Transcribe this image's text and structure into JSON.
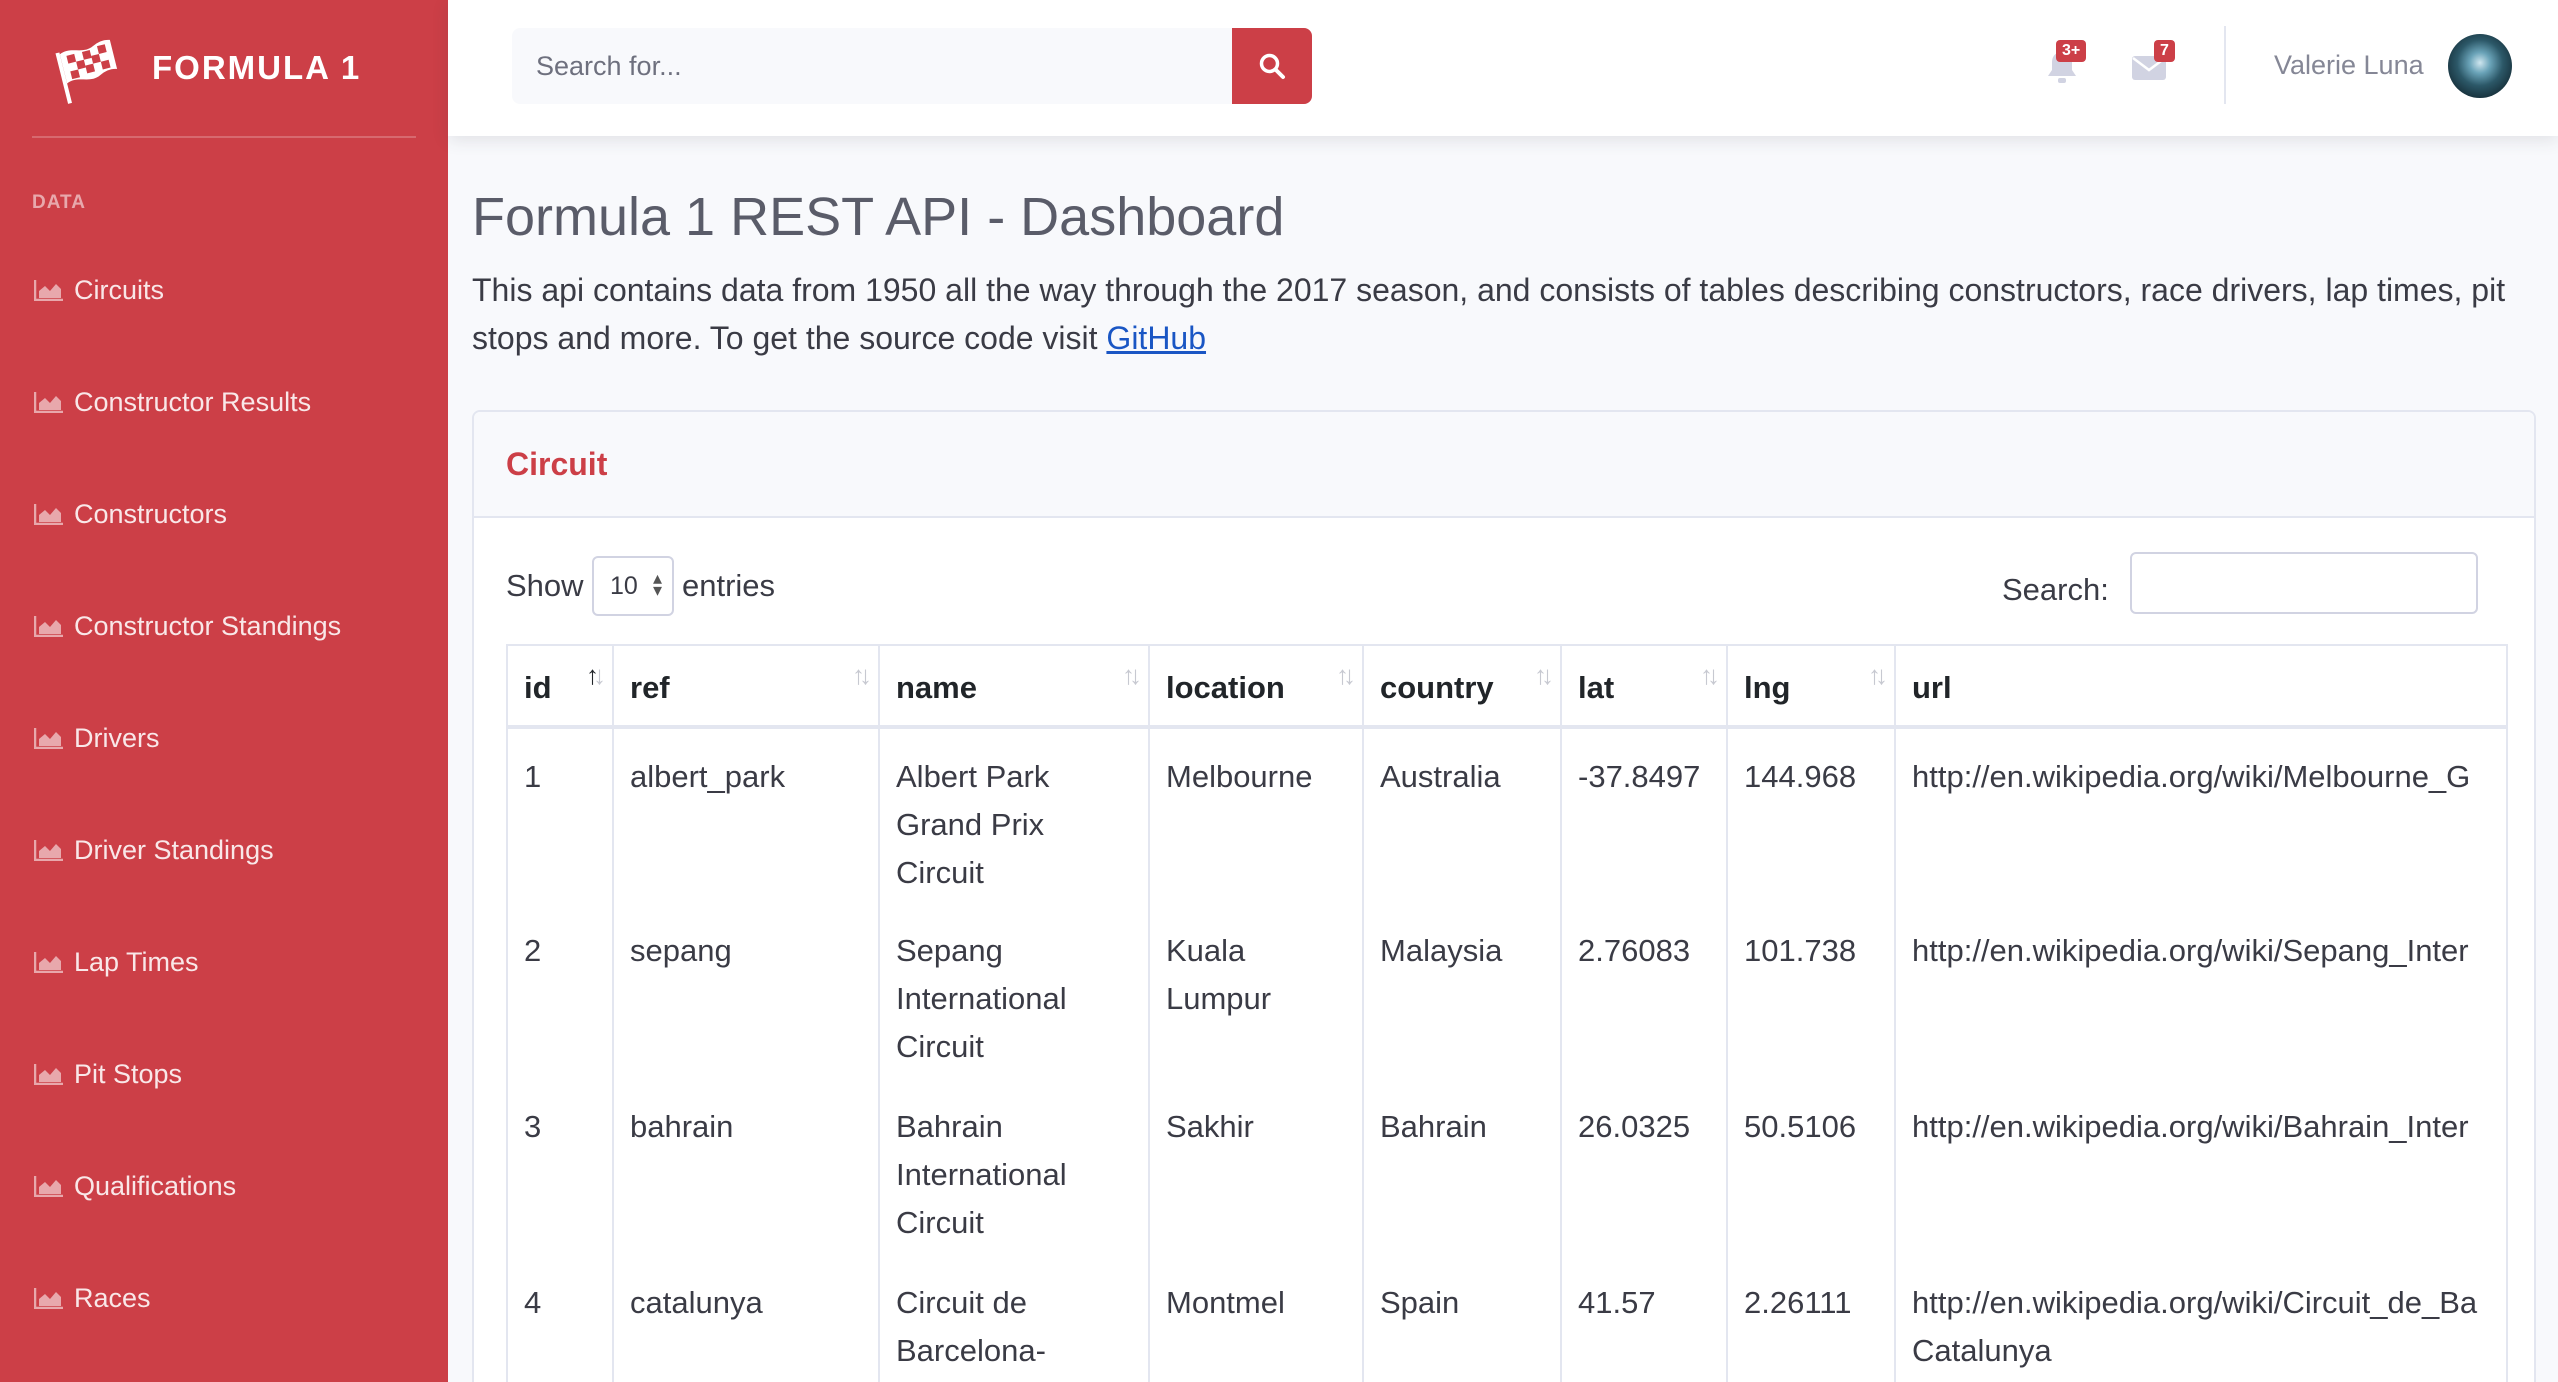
{
  "brand": {
    "title": "FORMULA 1",
    "icon": "checkered-flag-icon"
  },
  "sidebar": {
    "heading": "DATA",
    "items": [
      {
        "label": "Circuits",
        "icon": "chart-area-icon"
      },
      {
        "label": "Constructor Results",
        "icon": "chart-area-icon"
      },
      {
        "label": "Constructors",
        "icon": "chart-area-icon"
      },
      {
        "label": "Constructor Standings",
        "icon": "chart-area-icon"
      },
      {
        "label": "Drivers",
        "icon": "chart-area-icon"
      },
      {
        "label": "Driver Standings",
        "icon": "chart-area-icon"
      },
      {
        "label": "Lap Times",
        "icon": "chart-area-icon"
      },
      {
        "label": "Pit Stops",
        "icon": "chart-area-icon"
      },
      {
        "label": "Qualifications",
        "icon": "chart-area-icon"
      },
      {
        "label": "Races",
        "icon": "chart-area-icon"
      }
    ]
  },
  "topbar": {
    "search_placeholder": "Search for...",
    "alerts_badge": "3+",
    "messages_badge": "7",
    "user_name": "Valerie Luna"
  },
  "main": {
    "title": "Formula 1 REST API - Dashboard",
    "intro_text": "This api contains data from 1950 all the way through the 2017 season, and consists of tables describing constructors, race drivers, lap times, pit stops and more. To get the source code visit ",
    "intro_link": "GitHub"
  },
  "card": {
    "title": "Circuit",
    "show_label": "Show",
    "entries_value": "10",
    "entries_label": "entries",
    "search_label": "Search:",
    "columns": [
      "id",
      "ref",
      "name",
      "location",
      "country",
      "lat",
      "lng",
      "url"
    ],
    "rows": [
      [
        "1",
        "albert_park",
        "Albert Park Grand Prix Circuit",
        "Melbourne",
        "Australia",
        "-37.8497",
        "144.968",
        "http://en.wikipedia.org/wiki/Melbourne_G"
      ],
      [
        "2",
        "sepang",
        "Sepang International Circuit",
        "Kuala Lumpur",
        "Malaysia",
        "2.76083",
        "101.738",
        "http://en.wikipedia.org/wiki/Sepang_Inter"
      ],
      [
        "3",
        "bahrain",
        "Bahrain International Circuit",
        "Sakhir",
        "Bahrain",
        "26.0325",
        "50.5106",
        "http://en.wikipedia.org/wiki/Bahrain_Inter"
      ],
      [
        "4",
        "catalunya",
        "Circuit de Barcelona-Catalunya",
        "Montmel",
        "Spain",
        "41.57",
        "2.26111",
        "http://en.wikipedia.org/wiki/Circuit_de_Ba Catalunya"
      ]
    ]
  },
  "colors": {
    "primary": "#cc3f47",
    "text": "#5a5c69",
    "background": "#f8f9fc"
  }
}
